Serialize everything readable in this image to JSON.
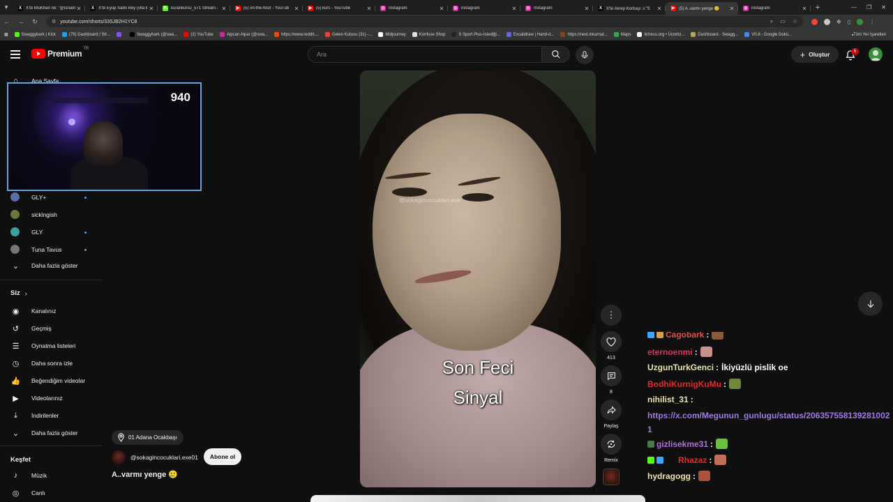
{
  "browser": {
    "tabs": [
      {
        "title": "X'te BtuKhan ne: \"@IsraelI",
        "fav_color": "#000000",
        "fav_glyph": "X",
        "active": false
      },
      {
        "title": "X'te Eyüp Sabri Bey (vita li",
        "fav_color": "#000000",
        "fav_glyph": "X",
        "active": false
      },
      {
        "title": "kurankursu_571 Stream -",
        "fav_color": "#53fc18",
        "fav_glyph": "K",
        "active": false
      },
      {
        "title": "(5) on-the-floor - YouTub",
        "fav_color": "#ff0000",
        "fav_glyph": "▶",
        "active": false
      },
      {
        "title": "(5) kurs - YouTube",
        "fav_color": "#ff0000",
        "fav_glyph": "▶",
        "active": false
      },
      {
        "title": "Instagram",
        "fav_color": "#d6249f",
        "fav_glyph": "◎",
        "active": false
      },
      {
        "title": "Instagram",
        "fav_color": "#d6249f",
        "fav_glyph": "◎",
        "active": false
      },
      {
        "title": "Instagram",
        "fav_color": "#d6249f",
        "fav_glyph": "◎",
        "active": false
      },
      {
        "title": "X'te Akrep Korbaşı ⚔\"S",
        "fav_color": "#000000",
        "fav_glyph": "X",
        "active": false
      },
      {
        "title": "(5) A..varmı yenge 🥲",
        "fav_color": "#ff0000",
        "fav_glyph": "▶",
        "active": true
      },
      {
        "title": "Instagram",
        "fav_color": "#d6249f",
        "fav_glyph": "◎",
        "active": false
      }
    ],
    "url": "youtube.com/shorts/33SJB2H1YC8",
    "bookmarks": [
      {
        "label": "Swaggybark | Kick",
        "color": "#53fc18"
      },
      {
        "label": "(79) Dashboard / Str...",
        "color": "#1da1f2"
      },
      {
        "label": "",
        "color": "#9146ff"
      },
      {
        "label": "Swaggybark (@swa...",
        "color": "#000000"
      },
      {
        "label": "(2) YouTube",
        "color": "#ff0000"
      },
      {
        "label": "Alpcan Alpar (@swa...",
        "color": "#d6249f"
      },
      {
        "label": "https://www.reddit....",
        "color": "#ff4500"
      },
      {
        "label": "Gelen Kutusu (31) -...",
        "color": "#ea4335"
      },
      {
        "label": "Midjourney",
        "color": "#ffffff"
      },
      {
        "label": "Konfuse Shop",
        "color": "#dddddd"
      },
      {
        "label": "S Sport Plus-İstediği...",
        "color": "#222222"
      },
      {
        "label": "Excalidraw | Hand-d...",
        "color": "#6965db"
      },
      {
        "label": "https://next.inkarnat...",
        "color": "#884422"
      },
      {
        "label": "Maps",
        "color": "#34a853"
      },
      {
        "label": "lichess.org • Ücretsi...",
        "color": "#ffffff"
      },
      {
        "label": "Dashboard - Swagg...",
        "color": "#c0a060"
      },
      {
        "label": "V0.8 - Google Dokü...",
        "color": "#4285f4"
      }
    ],
    "bookmarks_right": "Tüm Yer İşaretleri"
  },
  "header": {
    "logo_text": "Premium",
    "country": "TR",
    "search_placeholder": "Ara",
    "create_label": "Oluştur",
    "notif_count": "5"
  },
  "sidebar": {
    "top_item": "Ana Sayfa",
    "subs": [
      {
        "label": "GLY+",
        "color": "#5a6fa8",
        "live": true
      },
      {
        "label": "sickingish",
        "color": "#6a7a3a",
        "live": false
      },
      {
        "label": "GLY",
        "color": "#3aa0a0",
        "live": true
      },
      {
        "label": "Tuna Tavus",
        "color": "#777777",
        "live": true
      }
    ],
    "subs_more": "Daha fazla göster",
    "you_title": "Siz",
    "you_items": [
      {
        "label": "Kanalınız",
        "icon": "channel-icon"
      },
      {
        "label": "Geçmiş",
        "icon": "history-icon"
      },
      {
        "label": "Oynatma listeleri",
        "icon": "playlist-icon"
      },
      {
        "label": "Daha sonra izle",
        "icon": "watch-later-icon"
      },
      {
        "label": "Beğendiğim videolar",
        "icon": "like-icon"
      },
      {
        "label": "Videolarınız",
        "icon": "your-videos-icon"
      },
      {
        "label": "İndirilenler",
        "icon": "download-icon"
      },
      {
        "label": "Daha fazla göster",
        "icon": "chevron-down-icon"
      }
    ],
    "explore_title": "Keşfet",
    "explore_items": [
      {
        "label": "Müzik",
        "icon": "music-icon"
      },
      {
        "label": "Canlı",
        "icon": "live-icon"
      }
    ]
  },
  "webcam": {
    "counter": "940"
  },
  "short": {
    "watermark": "@sokagincocuklari.exe",
    "caption_line1": "Son Feci",
    "caption_line2": "Sinyal",
    "location": "01 Adana Ocakbaşı",
    "channel": "@sokagincocuklari.exe01",
    "subscribe_label": "Abone ol",
    "title": "A..varmı yenge 🥲"
  },
  "actions": {
    "likes": "413",
    "comments": "8",
    "share_label": "Paylaş",
    "remix_label": "Remix"
  },
  "chat": {
    "messages": [
      {
        "user": "Cagobark",
        "color": "#e0504a",
        "msg": "",
        "emote_color": "#8a5a3a",
        "badges": [
          "#3ea6ff",
          "#d4a050"
        ]
      },
      {
        "user": "eternoenmi",
        "color": "#e0305a",
        "msg": "",
        "emote_color": "#c9908a",
        "badges": []
      },
      {
        "user": "UzgunTurkGenci",
        "color": "#e9e3a8",
        "msg": "İkiyüzlü pislik oe",
        "emote_color": "",
        "badges": []
      },
      {
        "user": "BodhiKurnigKuMu",
        "color": "#e02a2a",
        "msg": "",
        "emote_color": "#6a8a3a",
        "badges": []
      },
      {
        "user": "nihilist_31",
        "color": "#e9e3a8",
        "msg": "",
        "emote_color": "",
        "badges": []
      },
      {
        "user": "gizlisekme31",
        "color": "#b070e0",
        "msg": "",
        "emote_color": "#6ac03a",
        "badges": [
          "#4a7a4a"
        ]
      },
      {
        "user": "Rhazaz",
        "color": "#e02a2a",
        "msg": "",
        "emote_color": "#c0705a",
        "badges": [
          "#53fc18",
          "#3ea6ff"
        ]
      },
      {
        "user": "hydragogg",
        "color": "#e9e3a8",
        "msg": "",
        "emote_color": "#b0503a",
        "badges": []
      }
    ],
    "link": "https://x.com/Megunun_gunlugu/status/2063575581392810021"
  }
}
